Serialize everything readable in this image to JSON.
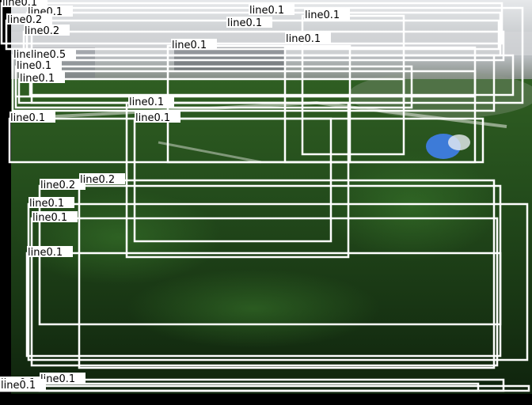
{
  "scene": {
    "description_colors": {
      "grass_dark": "#10270f",
      "grass_mid": "#1f4a1a",
      "grass_light": "#2f6a24",
      "background_band": "#c9ccd0",
      "field_line": "#d8ddd4",
      "ball_blue": "#3d7bd8"
    }
  },
  "detections": [
    {
      "label": "line0.1"
    },
    {
      "label": "line0.1"
    },
    {
      "label": "line0.2"
    },
    {
      "label": "line0.2"
    },
    {
      "label": "line0.1"
    },
    {
      "label": "line0.1"
    },
    {
      "label": "line0.1"
    },
    {
      "label": "line0.1"
    },
    {
      "label": "line0.5"
    },
    {
      "label": "line0.1"
    },
    {
      "label": "line0.1"
    },
    {
      "label": "line0.1"
    },
    {
      "label": "line0.1"
    },
    {
      "label": "line0.1"
    },
    {
      "label": "line0.1"
    },
    {
      "label": "line0.1"
    },
    {
      "label": "line0.2"
    },
    {
      "label": "line0.2"
    },
    {
      "label": "line0.1"
    },
    {
      "label": "line0.1"
    },
    {
      "label": "line0.1"
    },
    {
      "label": "line0.1"
    },
    {
      "label": "line0.1"
    },
    {
      "label": "line0.1"
    }
  ]
}
